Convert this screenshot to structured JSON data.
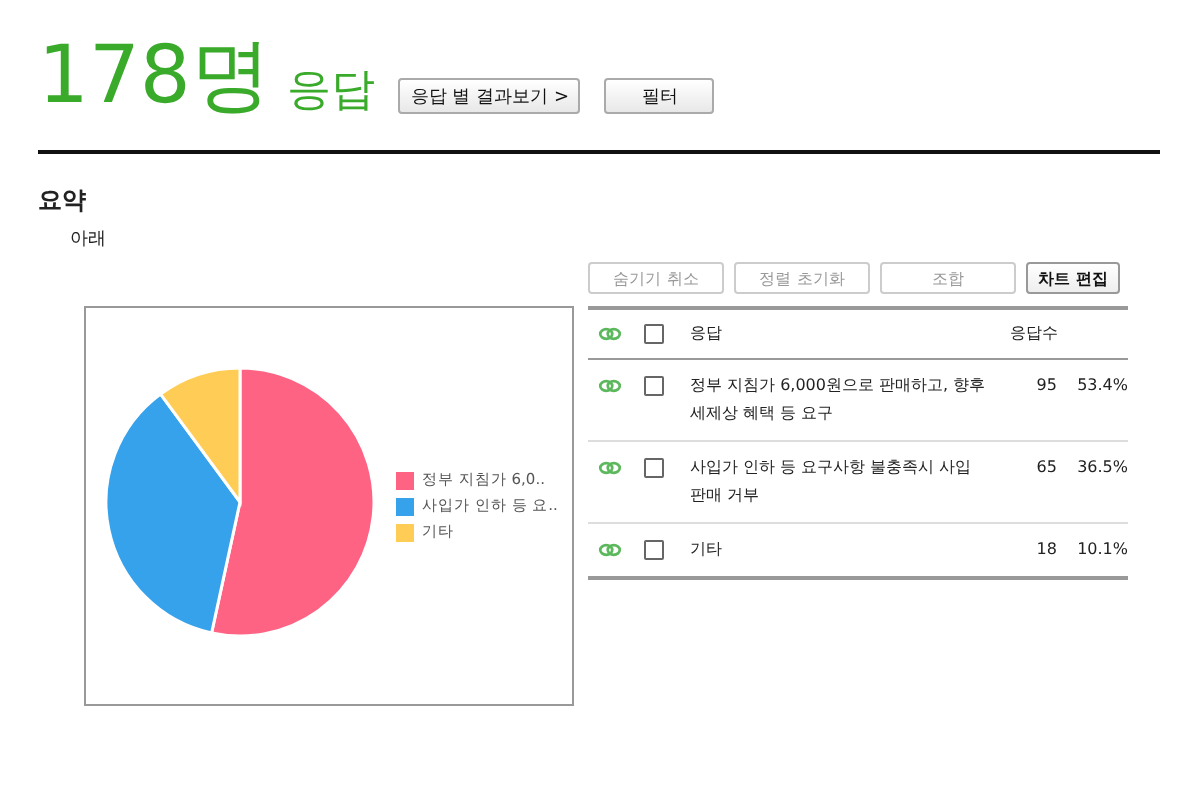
{
  "header": {
    "count": "178명",
    "count_label": "응답",
    "buttons": [
      {
        "label": "응답 별 결과보기 >"
      },
      {
        "label": "필터"
      }
    ]
  },
  "summary": {
    "title": "요약",
    "subtitle": "아래"
  },
  "chart": {
    "chart_data": {
      "type": "pie",
      "categories": [
        "정부 지침가 6,0..",
        "사입가 인하 등 요..",
        "기타"
      ],
      "series": [
        {
          "values": [
            53.4,
            36.5,
            10.1
          ]
        }
      ],
      "colors": [
        "#ff6384",
        "#36a2eb",
        "#ffcd56"
      ],
      "legend": "right"
    }
  },
  "toolbar": [
    {
      "label": "숨기기 취소",
      "disabled": true
    },
    {
      "label": "정렬 초기화",
      "disabled": true
    },
    {
      "label": "조합",
      "disabled": true
    },
    {
      "label": "차트 편집",
      "disabled": false
    }
  ],
  "table": {
    "columns": [
      "응답",
      "응답수"
    ],
    "header_checked": false,
    "rows": [
      {
        "text": "정부 지침가 6,000원으로 판매하고, 향후 세제상 혜택 등 요구",
        "count": "95",
        "percent": "53.4%",
        "checked": false
      },
      {
        "text": "사입가 인하 등 요구사항 불충족시 사입 판매 거부",
        "count": "65",
        "percent": "36.5%",
        "checked": false
      },
      {
        "text": "기타",
        "count": "18",
        "percent": "10.1%",
        "checked": false
      }
    ]
  }
}
